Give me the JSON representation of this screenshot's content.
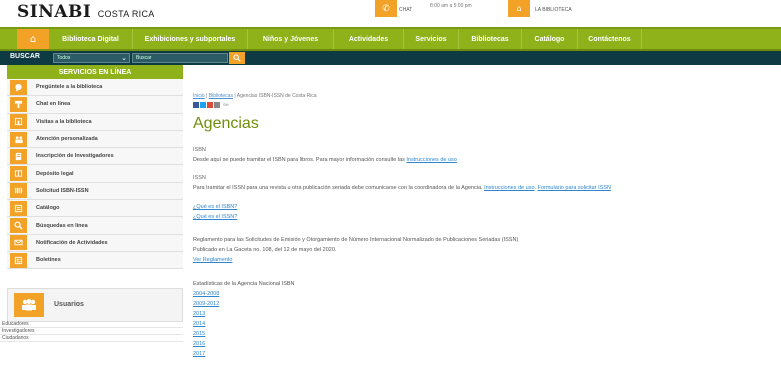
{
  "header": {
    "logo_main": "SINABI",
    "logo_sub": "COSTA RICA",
    "chat_label": "CHAT",
    "hours": "8:00 am a 5:00 pm",
    "library_label": "LA BIBLIOTECA"
  },
  "nav": {
    "items": [
      "Biblioteca Digital",
      "Exhibiciones y subportales",
      "Niños y Jóvenes",
      "Actividades",
      "Servicios",
      "Bibliotecas",
      "Catálogo",
      "Contáctenos"
    ]
  },
  "search": {
    "label": "BUSCAR",
    "select_value": "Todos",
    "placeholder": "Buscar"
  },
  "sidebar": {
    "title": "SERVICIOS EN LÍNEA",
    "items": [
      {
        "label": "Pregúntele a la biblioteca",
        "icon": "question-bubble-icon"
      },
      {
        "label": "Chat en línea",
        "icon": "chat-icon"
      },
      {
        "label": "Visitas a la biblioteca",
        "icon": "building-icon"
      },
      {
        "label": "Atención personalizada",
        "icon": "people-icon"
      },
      {
        "label": "Inscripción de Investigadores",
        "icon": "form-icon"
      },
      {
        "label": "Depósito legal",
        "icon": "book-icon"
      },
      {
        "label": "Solicitud ISBN-ISSN",
        "icon": "barcode-icon"
      },
      {
        "label": "Catálogo",
        "icon": "catalog-icon"
      },
      {
        "label": "Búsquedas en línea",
        "icon": "search-icon"
      },
      {
        "label": "Notificación de Actividades",
        "icon": "envelope-icon"
      },
      {
        "label": "Boletines",
        "icon": "newsletter-icon"
      }
    ],
    "users_title": "Usuarios",
    "users_list": [
      "Educadores",
      "Investigadores",
      "Ciudadanos"
    ]
  },
  "main": {
    "breadcrumb_home": "Inicio",
    "breadcrumb_sep1": " | ",
    "breadcrumb_library": "Bibliotecas",
    "breadcrumb_sep2": " | ",
    "breadcrumb_current": "Agencias ISBN-ISSN de Costa Rica",
    "share_count": "SH",
    "title": "Agencias",
    "isbn_head": "ISBN",
    "isbn_text": "Desde aquí se puede tramitar el ISBN para libros.  Para mayor información consulte las ",
    "isbn_link": "Instrucciones de uso",
    "issn_head": "ISSN",
    "issn_text": "Para tramitar el ISSN para una revista u otra publicación seriada debe comunicarse con la coordinadora de la Agencia. ",
    "issn_link1": "Instrucciones de uso",
    "issn_sep": ". ",
    "issn_link2": "Formulario para solicitar ISSN",
    "q_isbn": "¿Qué es el ISBN?",
    "q_issn": "¿Qué es el ISSN?",
    "reg_text": "Reglamento para las Solicitudes de Emisión y Otorgamiento de Número Internacional Normalizado de Publicaciones Seriadas (ISSN)",
    "reg_pub": "Publicado en La Gaceta no. 108, del 12 de mayo del 2020.",
    "reg_link": "Ver Reglamento",
    "stats_head": "Estadísticas de la Agencia Nacional ISBN",
    "stats_links": [
      "2004-2008",
      "2009-2012",
      "2013",
      "2014",
      "2015",
      "2016",
      "2017"
    ]
  },
  "colors": {
    "accent_green": "#8fb11a",
    "accent_orange": "#f2a226",
    "dark_bar": "#0e3a44",
    "link_blue": "#2f86cc"
  }
}
